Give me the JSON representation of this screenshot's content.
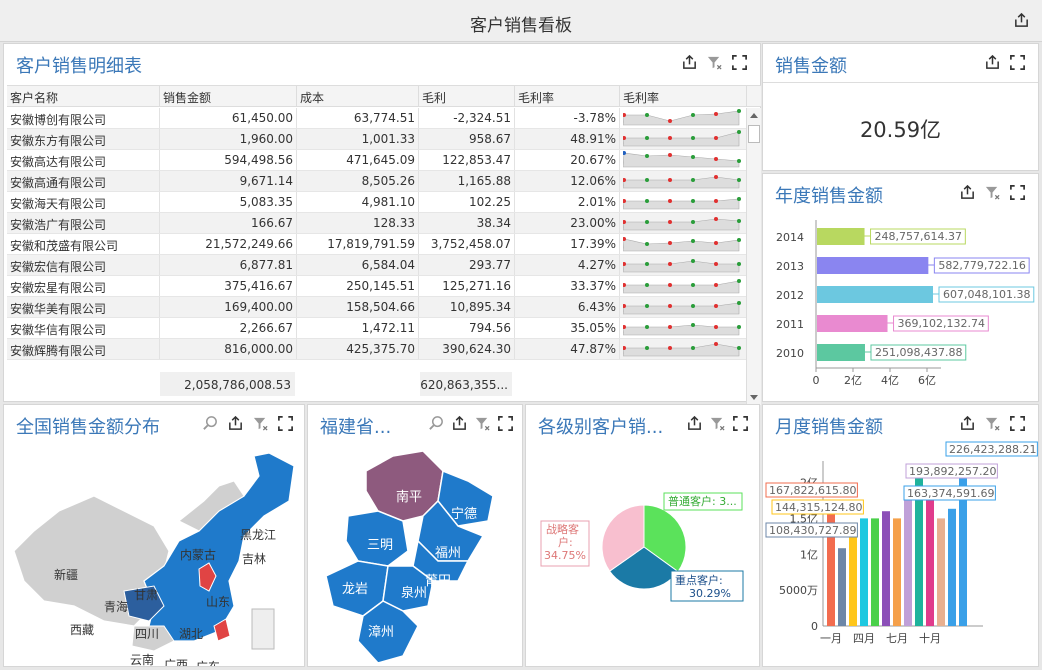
{
  "page_title": "客户销售看板",
  "detail": {
    "title": "客户销售明细表",
    "columns": [
      "客户名称",
      "销售金额",
      "成本",
      "毛利",
      "毛利率",
      "毛利率"
    ],
    "rows": [
      {
        "name": "安徽博创有限公司",
        "sales": "61,450.00",
        "cost": "63,774.51",
        "profit": "-2,324.51",
        "rate": "-3.78%",
        "trend": "down",
        "flag": false
      },
      {
        "name": "安徽东方有限公司",
        "sales": "1,960.00",
        "cost": "1,001.33",
        "profit": "958.67",
        "rate": "48.91%",
        "trend": "up",
        "flag": false
      },
      {
        "name": "安徽高达有限公司",
        "sales": "594,498.56",
        "cost": "471,645.09",
        "profit": "122,853.47",
        "rate": "20.67%",
        "trend": "",
        "flag": true
      },
      {
        "name": "安徽高通有限公司",
        "sales": "9,671.14",
        "cost": "8,505.26",
        "profit": "1,165.88",
        "rate": "12.06%",
        "trend": "",
        "flag": false
      },
      {
        "name": "安徽海天有限公司",
        "sales": "5,083.35",
        "cost": "4,981.10",
        "profit": "102.25",
        "rate": "2.01%",
        "trend": "",
        "flag": false
      },
      {
        "name": "安徽浩广有限公司",
        "sales": "166.67",
        "cost": "128.33",
        "profit": "38.34",
        "rate": "23.00%",
        "trend": "",
        "flag": false
      },
      {
        "name": "安徽和茂盛有限公司",
        "sales": "21,572,249.66",
        "cost": "17,819,791.59",
        "profit": "3,752,458.07",
        "rate": "17.39%",
        "trend": "",
        "flag": true
      },
      {
        "name": "安徽宏信有限公司",
        "sales": "6,877.81",
        "cost": "6,584.04",
        "profit": "293.77",
        "rate": "4.27%",
        "trend": "",
        "flag": false
      },
      {
        "name": "安徽宏星有限公司",
        "sales": "375,416.67",
        "cost": "250,145.51",
        "profit": "125,271.16",
        "rate": "33.37%",
        "trend": "up",
        "flag": false
      },
      {
        "name": "安徽华美有限公司",
        "sales": "169,400.00",
        "cost": "158,504.66",
        "profit": "10,895.34",
        "rate": "6.43%",
        "trend": "",
        "flag": false
      },
      {
        "name": "安徽华信有限公司",
        "sales": "2,266.67",
        "cost": "1,472.11",
        "profit": "794.56",
        "rate": "35.05%",
        "trend": "up",
        "flag": false
      },
      {
        "name": "安徽辉腾有限公司",
        "sales": "816,000.00",
        "cost": "425,375.70",
        "profit": "390,624.30",
        "rate": "47.87%",
        "trend": "up",
        "flag": true
      }
    ],
    "sum_sales": "2,058,786,008.53",
    "sum_profit": "620,863,355..."
  },
  "total": {
    "title": "销售金额",
    "value": "20.59亿"
  },
  "annual": {
    "title": "年度销售金额"
  },
  "china_map": {
    "title": "全国销售金额分布",
    "labels": [
      "黑龙江",
      "吉林",
      "内蒙古",
      "新疆",
      "甘肃",
      "青海",
      "山东",
      "西藏",
      "四川",
      "湖北",
      "云南",
      "广西",
      "广东"
    ]
  },
  "fujian_map": {
    "title": "福建省...",
    "labels": [
      "南平",
      "宁德",
      "三明",
      "福州",
      "龙岩",
      "莆田",
      "泉州",
      "漳州"
    ]
  },
  "level": {
    "title": "各级别客户销..."
  },
  "monthly": {
    "title": "月度销售金额"
  },
  "colors": {
    "accent": "#3b78b8",
    "map_blue": "#1f7acb",
    "map_red": "#e04444",
    "map_gray": "#d0d0d0"
  },
  "chart_data": [
    {
      "type": "bar",
      "title": "年度销售金额",
      "orientation": "horizontal",
      "categories": [
        "2010",
        "2011",
        "2012",
        "2013",
        "2014"
      ],
      "values": [
        251098437.88,
        369102132.74,
        607048101.38,
        582779722.16,
        248757614.37
      ],
      "labels": [
        "251,098,437.88",
        "369,102,132.74",
        "607,048,101.38",
        "582,779,722.16",
        "248,757,614.37"
      ],
      "colors": [
        "#5cc8a0",
        "#e98ad0",
        "#6cc8e0",
        "#8a85f0",
        "#b8d860"
      ],
      "xticks": [
        "0",
        "2亿",
        "4亿",
        "6亿"
      ],
      "xlim": [
        0,
        700000000
      ]
    },
    {
      "type": "pie",
      "title": "各级别客户销...",
      "slices": [
        {
          "name": "普通客户",
          "label": "普通客户: 3...",
          "value": 34.96,
          "color": "#5be25b"
        },
        {
          "name": "重点客户",
          "label": "重点客户: 30.29%",
          "value": 30.29,
          "color": "#1b7aa6"
        },
        {
          "name": "战略客户",
          "label": "战略客户: 34.75%",
          "value": 34.75,
          "color": "#f8bfcf"
        }
      ]
    },
    {
      "type": "bar",
      "title": "月度销售金额",
      "xticks": [
        "一月",
        "四月",
        "七月",
        "十月"
      ],
      "yticks": [
        "0",
        "5000万",
        "1亿",
        "1.5亿",
        "2亿"
      ],
      "ylim": [
        0,
        230000000
      ],
      "values": [
        167822615.8,
        108430727.89,
        144315124.8,
        150000000,
        150000000,
        160000000,
        150000000,
        193892257.2,
        210000000,
        190000000,
        150000000,
        163374591.69,
        226423288.21
      ],
      "colors": [
        "#f26c4f",
        "#6d87a8",
        "#ffc61a",
        "#1ec8e0",
        "#4ad04a",
        "#8c4fb8",
        "#f5a04a",
        "#c0a0d8",
        "#1fb39c",
        "#e03c8c",
        "#e8b090",
        "#3aa0e8",
        "#3aa0e8"
      ],
      "labels": [
        {
          "i": 0,
          "text": "167,822,615.80"
        },
        {
          "i": 1,
          "text": "108,430,727.89"
        },
        {
          "i": 2,
          "text": "144,315,124.80"
        },
        {
          "i": 7,
          "text": "193,892,257.20"
        },
        {
          "i": 11,
          "text": "163,374,591.69"
        },
        {
          "i": 12,
          "text": "226,423,288.21"
        }
      ]
    }
  ]
}
